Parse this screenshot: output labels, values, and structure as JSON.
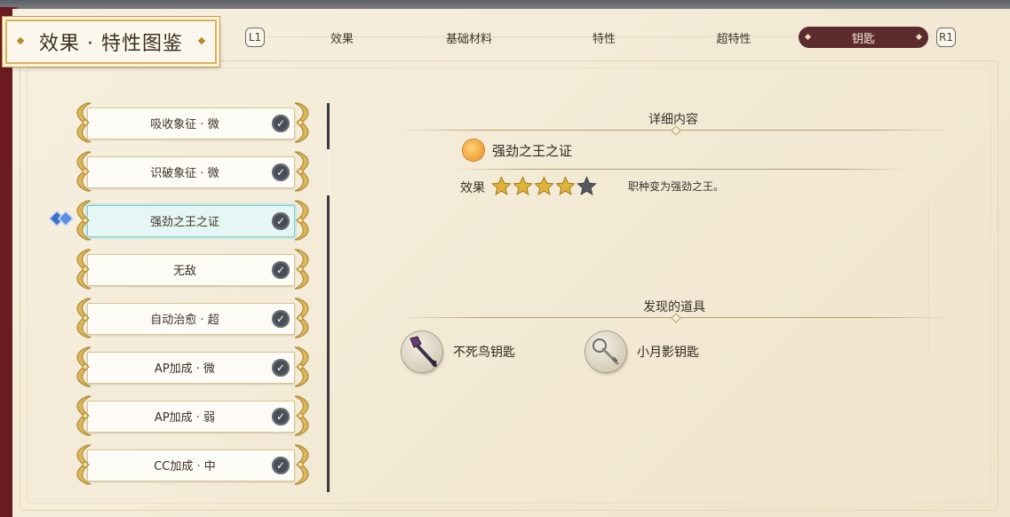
{
  "header": {
    "title": "效果 · 特性图鉴"
  },
  "tabs": {
    "left_button": "L1",
    "right_button": "R1",
    "items": [
      {
        "label": "效果"
      },
      {
        "label": "基础材料"
      },
      {
        "label": "特性"
      },
      {
        "label": "超特性"
      },
      {
        "label": "钥匙"
      }
    ],
    "active_index": 4
  },
  "effect_list": {
    "selected_index": 2,
    "items": [
      {
        "label": "吸收象征 · 微"
      },
      {
        "label": "识破象征 · 微"
      },
      {
        "label": "强劲之王之证"
      },
      {
        "label": "无敌"
      },
      {
        "label": "自动治愈 · 超"
      },
      {
        "label": "AP加成 · 微"
      },
      {
        "label": "AP加成 · 弱"
      },
      {
        "label": "CC加成 · 中"
      }
    ]
  },
  "detail": {
    "heading": "详细内容",
    "name": "强劲之王之证",
    "effect_label": "效果",
    "rating": 4,
    "rating_max": 5,
    "description": "职种变为强劲之王。",
    "found_heading": "发现的道具",
    "items": [
      {
        "name": "不死鸟钥匙",
        "icon": "phoenix-key-icon"
      },
      {
        "name": "小月影钥匙",
        "icon": "moonshadow-key-icon"
      }
    ]
  },
  "colors": {
    "active_tab": "#5c2b2e",
    "selected_item": "#e6f6f5",
    "star_gold": "#e2b437",
    "star_empty": "#55585e",
    "check": "#4a4f57",
    "cursor": "#4a7fd0"
  }
}
